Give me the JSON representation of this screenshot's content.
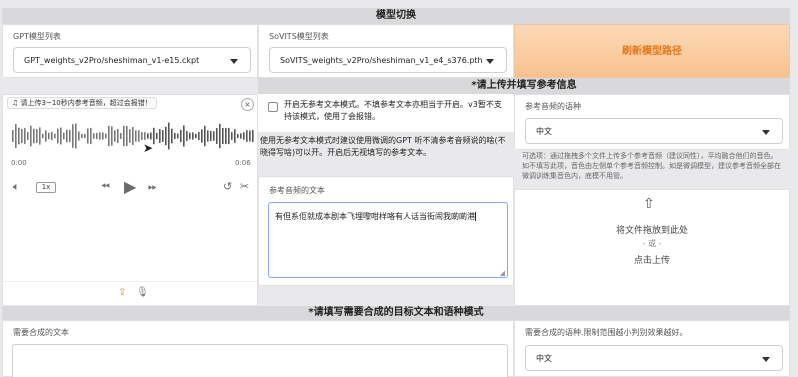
{
  "header": {
    "title": "模型切换"
  },
  "gpt_model": {
    "label": "GPT模型列表",
    "selected": "GPT_weights_v2Pro/sheshiman_v1-e15.ckpt"
  },
  "sovits_model": {
    "label": "SoVITS模型列表",
    "selected": "SoVITS_weights_v2Pro/sheshiman_v1_e4_s376.pth"
  },
  "refresh_button": {
    "label": "刷新模型路径",
    "color": "#f08a3c"
  },
  "ref_section": {
    "title": "*请上传并填写参考信息"
  },
  "audio": {
    "tip": "请上传3~10秒内参考音频，超过会报错！",
    "time_start": "0:00",
    "time_end": "0:06",
    "speed": "1x",
    "icons": [
      "music-note-icon",
      "close-icon",
      "volume-icon",
      "rewind-icon",
      "play-icon",
      "fast-forward-icon",
      "undo-icon",
      "scissors-icon",
      "upload-icon",
      "microphone-icon"
    ]
  },
  "no_ref_mode": {
    "label": "开启无参考文本模式。不填参考文本亦相当于开启。v3暂不支持该模式，使用了会报错。",
    "checked": false,
    "hint": "使用无参考文本模式时建议使用微调的GPT 听不清参考音频说的啥(不晓得写啥)可以开。开启后无视填写的参考文本。"
  },
  "ref_text": {
    "label": "参考音频的文本",
    "value": "有但系佢就成本剧本飞埋嚟咁样咯有人话当街闹我啲啲港"
  },
  "ref_lang": {
    "label": "参考音频的语种",
    "selected": "中文",
    "note": "可选项：通过拖拽多个文件上传多个参考音频（建议同性），平均融合他们的音色。如不填写此项，音色由左侧单个参考音频控制。如是微调模型，建议参考音频全部在微调训练集音色内，底模不用管。"
  },
  "dropzone": {
    "line1": "将文件拖放到此处",
    "line2": "- 或 -",
    "line3": "点击上传"
  },
  "target_section": {
    "title": "*请填写需要合成的目标文本和语种模式"
  },
  "target_text": {
    "label": "需要合成的文本",
    "value": ""
  },
  "target_lang": {
    "label": "需要合成的语种.限制范围越小判别效果越好。",
    "selected": "中文"
  }
}
